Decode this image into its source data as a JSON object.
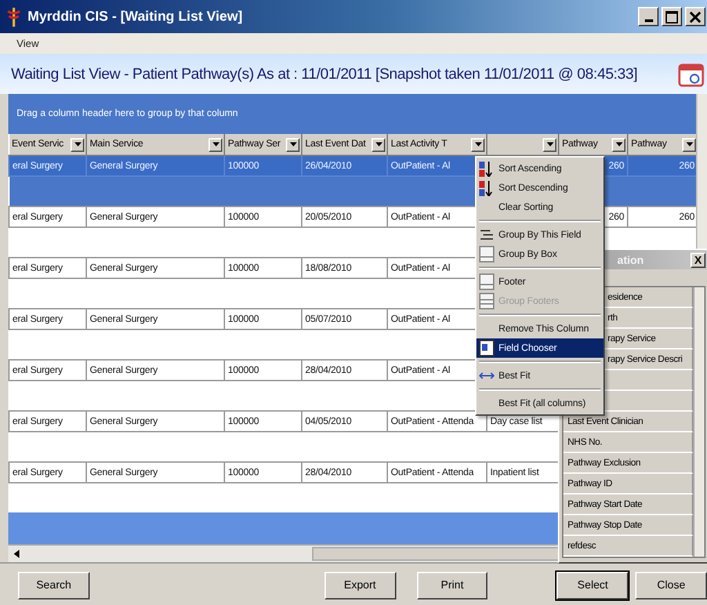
{
  "window": {
    "title": "Myrddin CIS - [Waiting List View]"
  },
  "menu_bar": [
    "View"
  ],
  "heading": "Waiting List View - Patient Pathway(s) As at : 11/01/2011 [Snapshot taken 11/01/2011 @ 08:45:33]",
  "group_box": {
    "hint": "Drag a column header here to group by that column"
  },
  "table": {
    "columns": [
      {
        "label": "Event Servic"
      },
      {
        "label": "Main Service"
      },
      {
        "label": "Pathway Ser"
      },
      {
        "label": "Last Event Dat"
      },
      {
        "label": "Last Activity T"
      },
      {},
      {
        "label": "Pathway"
      },
      {
        "label": "Pathway"
      }
    ],
    "rows": [
      {
        "selected": true,
        "cells": [
          "eral Surgery",
          "General Surgery",
          "100000",
          "26/04/2010",
          "OutPatient - Al",
          null,
          "260",
          "260"
        ]
      },
      {
        "selected": false,
        "cells": [
          "eral Surgery",
          "General Surgery",
          "100000",
          "20/05/2010",
          "OutPatient - Al",
          null,
          "260",
          "260"
        ]
      },
      {
        "selected": false,
        "cells": [
          "eral Surgery",
          "General Surgery",
          "100000",
          "18/08/2010",
          "OutPatient - Al",
          null,
          null,
          null
        ]
      },
      {
        "selected": false,
        "cells": [
          "eral Surgery",
          "General Surgery",
          "100000",
          "05/07/2010",
          "OutPatient - Al",
          null,
          null,
          null
        ]
      },
      {
        "selected": false,
        "cells": [
          "eral Surgery",
          "General Surgery",
          "100000",
          "28/04/2010",
          "OutPatient - Al",
          null,
          null,
          null
        ]
      },
      {
        "selected": false,
        "cells": [
          "eral Surgery",
          "General Surgery",
          "100000",
          "04/05/2010",
          "OutPatient - Attenda",
          "Day case list",
          null,
          null
        ]
      },
      {
        "selected": false,
        "cells": [
          "eral Surgery",
          "General Surgery",
          "100000",
          "28/04/2010",
          "OutPatient - Attenda",
          "Inpatient list",
          null,
          null
        ]
      }
    ]
  },
  "context_menu": {
    "items": [
      {
        "kind": "item",
        "label": "Sort Ascending",
        "selected": false,
        "disabled": false
      },
      {
        "kind": "item",
        "label": "Sort Descending",
        "selected": false,
        "disabled": false
      },
      {
        "kind": "item",
        "label": "Clear Sorting",
        "selected": false,
        "disabled": false
      },
      {
        "kind": "separator"
      },
      {
        "kind": "item",
        "label": "Group By This Field",
        "selected": false,
        "disabled": false
      },
      {
        "kind": "item",
        "label": "Group By Box",
        "selected": false,
        "disabled": false
      },
      {
        "kind": "separator"
      },
      {
        "kind": "item",
        "label": "Footer",
        "selected": false,
        "disabled": false
      },
      {
        "kind": "item",
        "label": "Group Footers",
        "selected": false,
        "disabled": true
      },
      {
        "kind": "separator"
      },
      {
        "kind": "item",
        "label": "Remove This Column",
        "selected": false,
        "disabled": false
      },
      {
        "kind": "item",
        "label": "Field Chooser",
        "selected": true,
        "disabled": false
      },
      {
        "kind": "separator"
      },
      {
        "kind": "item",
        "label": "Best Fit",
        "selected": false,
        "disabled": false
      },
      {
        "kind": "separator"
      },
      {
        "kind": "item",
        "label": "Best Fit (all columns)",
        "selected": false,
        "disabled": false
      }
    ]
  },
  "field_chooser": {
    "title": "ation",
    "close": "X",
    "items": [
      {
        "kind": "covered",
        "label": "esidence"
      },
      {
        "kind": "covered",
        "label": "rth"
      },
      {
        "kind": "covered",
        "label": "rapy Service"
      },
      {
        "kind": "covered",
        "label": "rapy Service Descri"
      },
      {
        "kind": "hidden"
      },
      {
        "kind": "hidden"
      },
      {
        "kind": "full",
        "label": "Last Event Clinician"
      },
      {
        "kind": "full",
        "label": "NHS No."
      },
      {
        "kind": "full",
        "label": "Pathway Exclusion"
      },
      {
        "kind": "full",
        "label": "Pathway ID"
      },
      {
        "kind": "full",
        "label": "Pathway Start Date"
      },
      {
        "kind": "full",
        "label": "Pathway Stop Date"
      },
      {
        "kind": "full",
        "label": "refdesc"
      }
    ]
  },
  "buttons": [
    "Search",
    "Export",
    "Print",
    "Select",
    "Close"
  ]
}
